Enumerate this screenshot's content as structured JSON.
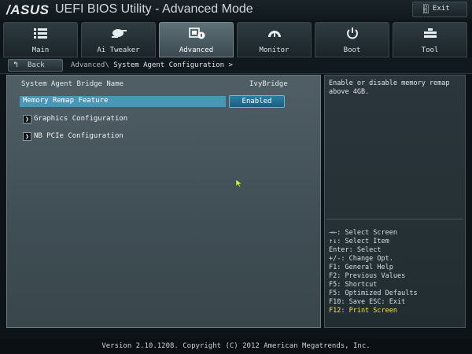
{
  "window": {
    "brand": "/ASUS",
    "title": "UEFI BIOS Utility - Advanced Mode",
    "exit_label": "Exit"
  },
  "tabs": [
    {
      "label": "Main",
      "icon": "list-icon"
    },
    {
      "label": "Ai Tweaker",
      "icon": "satellite-icon"
    },
    {
      "label": "Advanced",
      "icon": "chip-info-icon"
    },
    {
      "label": "Monitor",
      "icon": "gauge-icon"
    },
    {
      "label": "Boot",
      "icon": "power-icon"
    },
    {
      "label": "Tool",
      "icon": "toolbox-icon"
    }
  ],
  "active_tab": "Advanced",
  "breadcrumb": {
    "back_label": "Back",
    "root": "Advanced\\",
    "current": "System Agent Configuration >"
  },
  "main": {
    "bridge_label": "System Agent Bridge Name",
    "bridge_value": "IvyBridge",
    "selected_item": {
      "label": "Memory Remap Feature",
      "value": "Enabled"
    },
    "submenus": [
      {
        "label": "Graphics Configuration"
      },
      {
        "label": "NB PCIe Configuration"
      }
    ]
  },
  "help": {
    "description": "Enable or disable memory remap above 4GB.",
    "keys": [
      "→←: Select Screen",
      "↑↓: Select Item",
      "Enter: Select",
      "+/-: Change Opt.",
      "F1: General Help",
      "F2: Previous Values",
      "F5: Shortcut",
      "F5: Optimized Defaults",
      "F10: Save  ESC: Exit",
      "F12: Print Screen"
    ]
  },
  "footer": "Version 2.10.1208. Copyright (C) 2012 American Megatrends, Inc.",
  "colors": {
    "accent": "#4a97b5",
    "highlight_key": "#f4e23a",
    "panel": "#4f5f65"
  }
}
